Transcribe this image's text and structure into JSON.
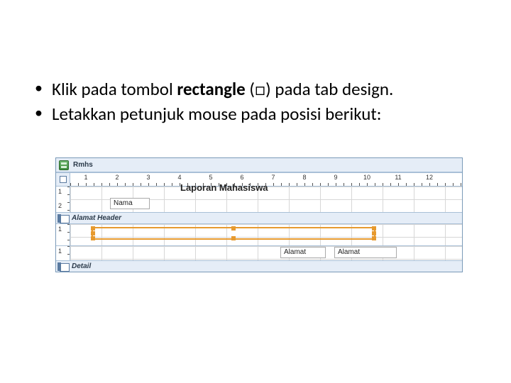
{
  "bullets": [
    {
      "prefix": "Klik pada tombol ",
      "bold": "rectangle",
      "suffix": " (□) pada tab design."
    },
    {
      "text": "Letakkan petunjuk mouse pada posisi berikut:"
    }
  ],
  "screenshot": {
    "form_name": "Rmhs",
    "ruler_numbers": [
      "1",
      "2",
      "3",
      "4",
      "5",
      "6",
      "7",
      "8",
      "9",
      "10",
      "11",
      "12"
    ],
    "report_title": "Laporan Mahasiswa",
    "nama_label": "Nama",
    "alamat_header": "Alamat Header",
    "alamat_label_left": "Alamat",
    "alamat_label_right": "Alamat",
    "detail_label": "Detail",
    "vruler": {
      "one": "1",
      "two": "2"
    }
  }
}
